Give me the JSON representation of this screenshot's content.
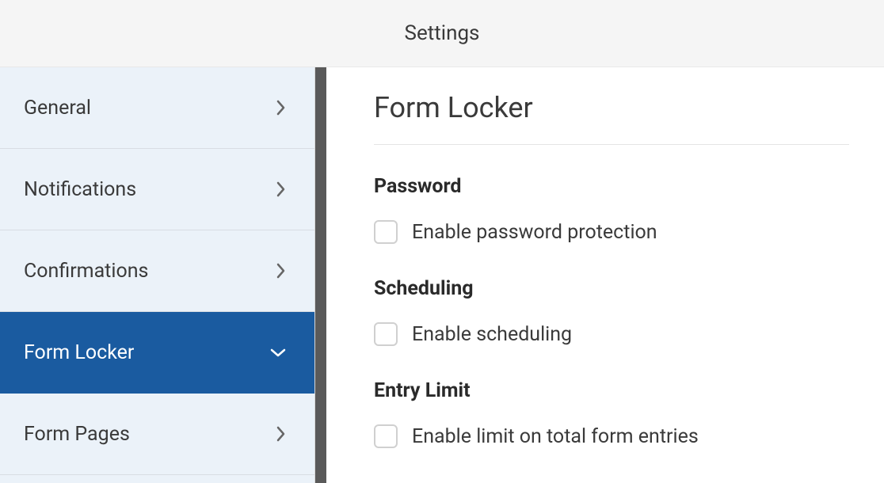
{
  "header": {
    "title": "Settings"
  },
  "sidebar": {
    "items": [
      {
        "label": "General",
        "active": false
      },
      {
        "label": "Notifications",
        "active": false
      },
      {
        "label": "Confirmations",
        "active": false
      },
      {
        "label": "Form Locker",
        "active": true
      },
      {
        "label": "Form Pages",
        "active": false
      }
    ]
  },
  "content": {
    "title": "Form Locker",
    "sections": [
      {
        "heading": "Password",
        "checkbox_label": "Enable password protection"
      },
      {
        "heading": "Scheduling",
        "checkbox_label": "Enable scheduling"
      },
      {
        "heading": "Entry Limit",
        "checkbox_label": "Enable limit on total form entries"
      }
    ]
  }
}
